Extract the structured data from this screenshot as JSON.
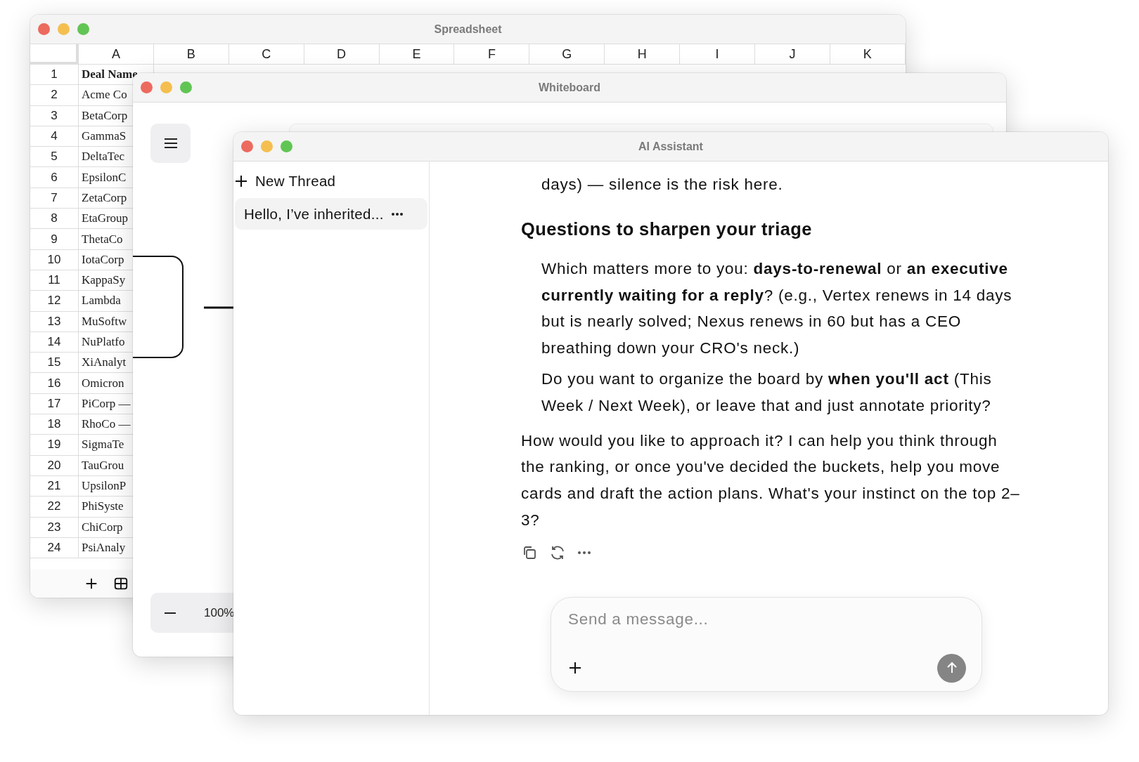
{
  "spreadsheet": {
    "title": "Spreadsheet",
    "columns": [
      "A",
      "B",
      "C",
      "D",
      "E",
      "F",
      "G",
      "H",
      "I",
      "J",
      "K"
    ],
    "header_row": {
      "number": "1",
      "cells": [
        "Deal Name"
      ]
    },
    "rows": [
      {
        "number": "2",
        "cell": "Acme Co"
      },
      {
        "number": "3",
        "cell": "BetaCorp"
      },
      {
        "number": "4",
        "cell": "GammaS"
      },
      {
        "number": "5",
        "cell": "DeltaTec"
      },
      {
        "number": "6",
        "cell": "EpsilonC"
      },
      {
        "number": "7",
        "cell": "ZetaCorp"
      },
      {
        "number": "8",
        "cell": "EtaGroup"
      },
      {
        "number": "9",
        "cell": "ThetaCo"
      },
      {
        "number": "10",
        "cell": "IotaCorp"
      },
      {
        "number": "11",
        "cell": "KappaSy"
      },
      {
        "number": "12",
        "cell": "Lambda"
      },
      {
        "number": "13",
        "cell": "MuSoftw"
      },
      {
        "number": "14",
        "cell": "NuPlatfo"
      },
      {
        "number": "15",
        "cell": "XiAnalyt"
      },
      {
        "number": "16",
        "cell": "Omicron"
      },
      {
        "number": "17",
        "cell": "PiCorp —"
      },
      {
        "number": "18",
        "cell": "RhoCo —"
      },
      {
        "number": "19",
        "cell": "SigmaTe"
      },
      {
        "number": "20",
        "cell": "TauGrou"
      },
      {
        "number": "21",
        "cell": "UpsilonP"
      },
      {
        "number": "22",
        "cell": "PhiSyste"
      },
      {
        "number": "23",
        "cell": "ChiCorp"
      },
      {
        "number": "24",
        "cell": "PsiAnaly"
      }
    ]
  },
  "whiteboard": {
    "title": "Whiteboard",
    "zoom": "100%"
  },
  "assistant": {
    "title": "AI Assistant",
    "new_thread": "New Thread",
    "threads": [
      {
        "label": "Hello, I’ve inherited...",
        "selected": true
      }
    ],
    "messages": [
      {
        "kind": "indented",
        "text": "days) — silence is the risk here."
      },
      {
        "kind": "heading",
        "text": "Questions to sharpen your triage"
      },
      {
        "kind": "indented",
        "text": "Which matters more to you: **days-to-renewal** or **an executive currently waiting for a reply**? (e.g., Vertex renews in 14 days but is nearly solved; Nexus renews in 60 but has a CEO breathing down your CRO's neck.)"
      },
      {
        "kind": "indented",
        "text": "Do you want to organize the board by **when you'll act** (This Week / Next Week), or leave that and just annotate priority?"
      },
      {
        "kind": "paragraph",
        "text": "How would you like to approach it? I can help you think through the ranking, or once you've decided the buckets, help you move cards and draft the action plans. What's your instinct on the top 2–3?"
      }
    ],
    "composer": {
      "placeholder": "Send a message..."
    }
  }
}
